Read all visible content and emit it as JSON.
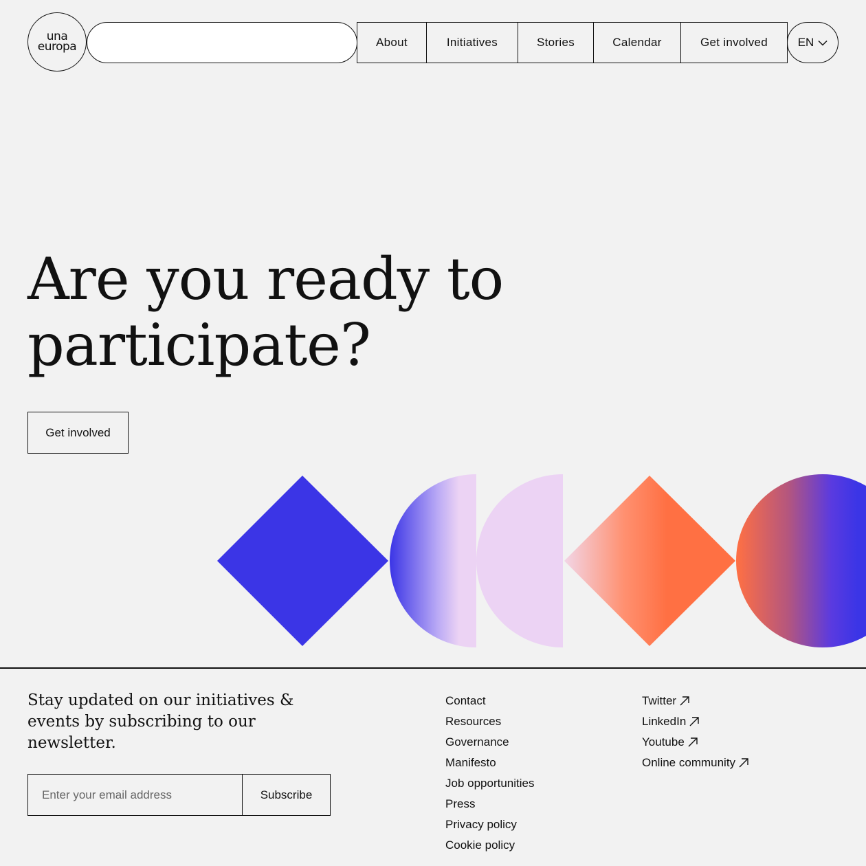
{
  "header": {
    "logo_line1": "una",
    "logo_line2": "europa",
    "search_value": "",
    "nav": [
      {
        "label": "About"
      },
      {
        "label": "Initiatives"
      },
      {
        "label": "Stories"
      },
      {
        "label": "Calendar"
      },
      {
        "label": "Get involved"
      }
    ],
    "language": "EN",
    "language_icon": "chevron-down-icon"
  },
  "hero": {
    "title_line1": "Are you ready to",
    "title_line2": "participate?",
    "cta_label": "Get involved"
  },
  "colors": {
    "background": "#f2f2f2",
    "blue": "#3b35e6",
    "lilac": "#ecd3f4",
    "orange": "#ff7043"
  },
  "footer": {
    "newsletter_text": "Stay updated on our initiatives & events by subscribing to our newsletter.",
    "email_placeholder": "Enter your email address",
    "subscribe_label": "Subscribe",
    "links": [
      {
        "label": "Contact"
      },
      {
        "label": "Resources"
      },
      {
        "label": "Governance"
      },
      {
        "label": "Manifesto"
      },
      {
        "label": "Job opportunities"
      },
      {
        "label": "Press"
      },
      {
        "label": "Privacy policy"
      },
      {
        "label": "Cookie policy"
      }
    ],
    "social": [
      {
        "label": "Twitter",
        "icon": "external-arrow-icon"
      },
      {
        "label": "LinkedIn",
        "icon": "external-arrow-icon"
      },
      {
        "label": "Youtube",
        "icon": "external-arrow-icon"
      },
      {
        "label": "Online community",
        "icon": "external-arrow-icon"
      }
    ]
  }
}
